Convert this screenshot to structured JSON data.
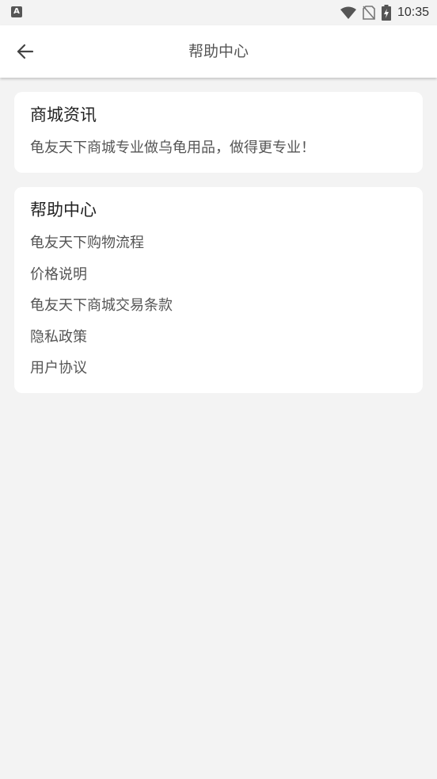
{
  "status_bar": {
    "left_icon": "A",
    "time": "10:35",
    "icons": [
      "wifi-icon",
      "no-sim-icon",
      "battery-charging-icon"
    ]
  },
  "toolbar": {
    "back_icon": "arrow-left-icon",
    "title": "帮助中心"
  },
  "news_card": {
    "title": "商城资讯",
    "text": "龟友天下商城专业做乌龟用品，做得更专业！"
  },
  "help_card": {
    "title": "帮助中心",
    "items": [
      {
        "label": "龟友天下购物流程"
      },
      {
        "label": "价格说明"
      },
      {
        "label": "龟友天下商城交易条款"
      },
      {
        "label": "隐私政策"
      },
      {
        "label": "用户协议"
      }
    ]
  }
}
